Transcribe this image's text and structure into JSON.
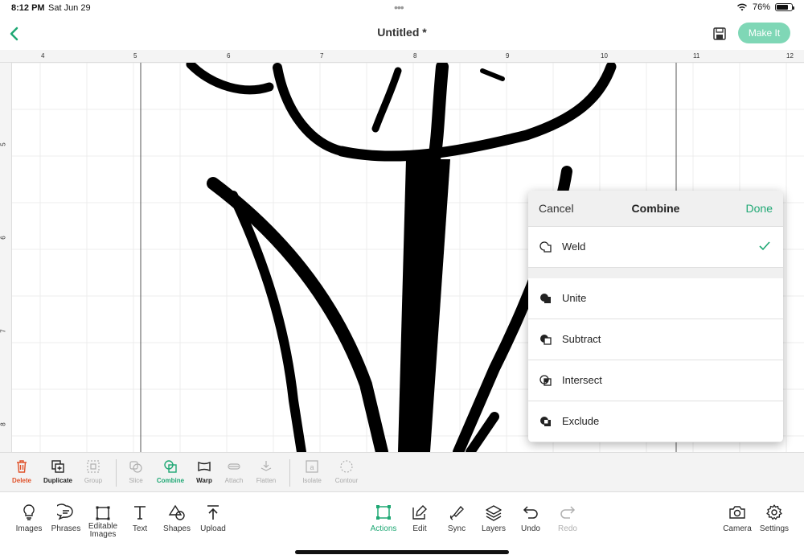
{
  "status_bar": {
    "time": "8:12 PM",
    "date": "Sat Jun 29",
    "battery": "76%",
    "battery_level": 0.76
  },
  "nav": {
    "title": "Untitled  *",
    "make_it_label": "Make It"
  },
  "ruler": {
    "top_labels": [
      "4",
      "5",
      "6",
      "7",
      "8",
      "9",
      "10",
      "11",
      "12"
    ],
    "left_labels": [
      "5",
      "6",
      "7",
      "8"
    ]
  },
  "combine_popover": {
    "cancel_label": "Cancel",
    "title": "Combine",
    "done_label": "Done",
    "options": [
      {
        "label": "Weld",
        "icon": "weld-icon",
        "selected": true
      },
      {
        "label": "Unite",
        "icon": "unite-icon",
        "selected": false
      },
      {
        "label": "Subtract",
        "icon": "subtract-icon",
        "selected": false
      },
      {
        "label": "Intersect",
        "icon": "intersect-icon",
        "selected": false
      },
      {
        "label": "Exclude",
        "icon": "exclude-icon",
        "selected": false
      }
    ]
  },
  "edit_toolbar": {
    "items": [
      {
        "label": "Delete",
        "icon": "trash-icon",
        "state": "delete"
      },
      {
        "label": "Duplicate",
        "icon": "duplicate-icon",
        "state": "enabled"
      },
      {
        "label": "Group",
        "icon": "group-icon",
        "state": "disabled"
      },
      {
        "label": "Slice",
        "icon": "slice-icon",
        "state": "disabled"
      },
      {
        "label": "Combine",
        "icon": "combine-icon",
        "state": "active"
      },
      {
        "label": "Warp",
        "icon": "warp-icon",
        "state": "enabled"
      },
      {
        "label": "Attach",
        "icon": "attach-icon",
        "state": "disabled"
      },
      {
        "label": "Flatten",
        "icon": "flatten-icon",
        "state": "disabled"
      },
      {
        "label": "Isolate",
        "icon": "isolate-icon",
        "state": "disabled"
      },
      {
        "label": "Contour",
        "icon": "contour-icon",
        "state": "disabled"
      }
    ]
  },
  "main_toolbar": {
    "items": [
      {
        "label": "Images",
        "icon": "images-icon"
      },
      {
        "label": "Phrases",
        "icon": "phrases-icon"
      },
      {
        "label": "Editable Images",
        "icon": "editable-images-icon"
      },
      {
        "label": "Text",
        "icon": "text-icon"
      },
      {
        "label": "Shapes",
        "icon": "shapes-icon"
      },
      {
        "label": "Upload",
        "icon": "upload-icon"
      },
      {
        "label": "Actions",
        "icon": "actions-icon",
        "active": true
      },
      {
        "label": "Edit",
        "icon": "edit-icon"
      },
      {
        "label": "Sync",
        "icon": "sync-icon"
      },
      {
        "label": "Layers",
        "icon": "layers-icon"
      },
      {
        "label": "Undo",
        "icon": "undo-icon"
      },
      {
        "label": "Redo",
        "icon": "redo-icon",
        "disabled": true
      },
      {
        "label": "Camera",
        "icon": "camera-icon"
      },
      {
        "label": "Settings",
        "icon": "settings-icon"
      }
    ]
  },
  "colors": {
    "accent": "#1fa874",
    "make_it_bg": "#7fd7b6",
    "delete": "#e0522a",
    "disabled": "#b0b0b0"
  }
}
